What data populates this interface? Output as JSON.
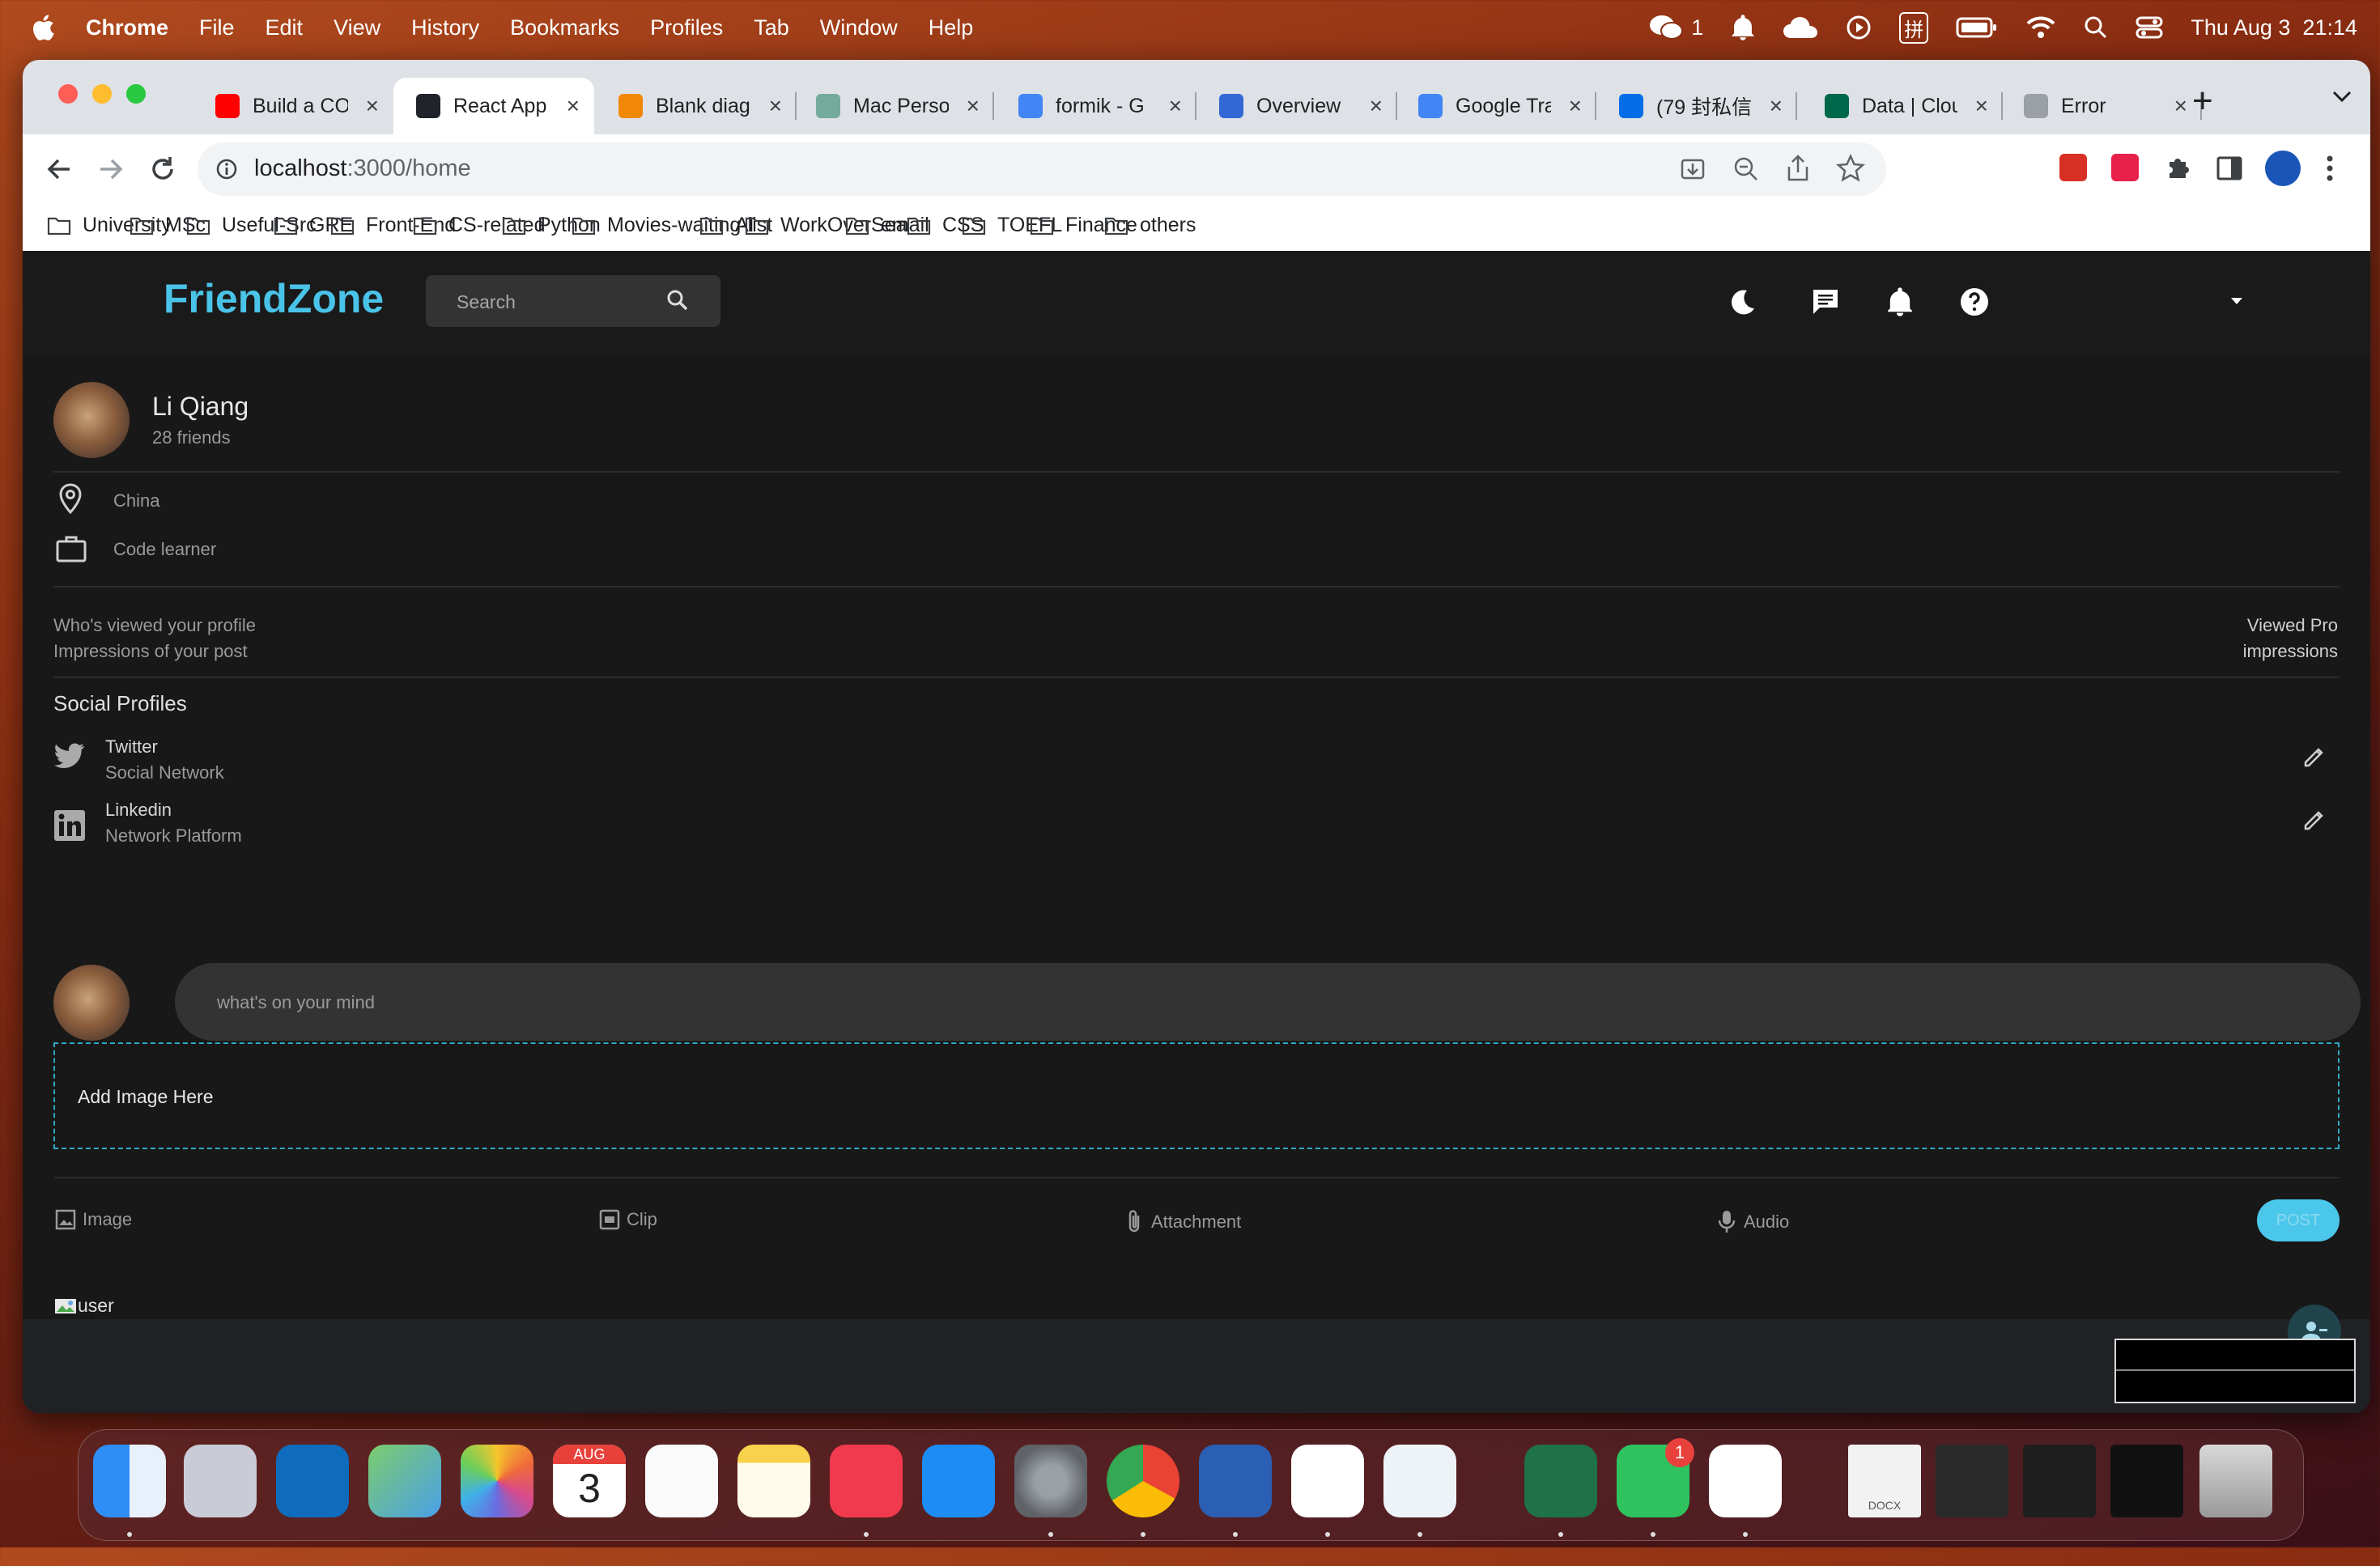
{
  "menubar": {
    "app": "Chrome",
    "items": [
      "File",
      "Edit",
      "View",
      "History",
      "Bookmarks",
      "Profiles",
      "Tab",
      "Window",
      "Help"
    ],
    "wechat_count": "1",
    "input_method": "拼",
    "datetime": "Thu Aug 3  21:14"
  },
  "tabs": [
    {
      "title": "Build a CO",
      "fav_color": "#ff0000"
    },
    {
      "title": "React App",
      "fav_color": "#20232a"
    },
    {
      "title": "Blank diag",
      "fav_color": "#f08705"
    },
    {
      "title": "Mac Perso",
      "fav_color": "#74aa9c"
    },
    {
      "title": "formik - G",
      "fav_color": "#4285f4"
    },
    {
      "title": "Overview",
      "fav_color": "#3367d6"
    },
    {
      "title": "Google Tra",
      "fav_color": "#4285f4"
    },
    {
      "title": "(79 封私信",
      "fav_color": "#056de8"
    },
    {
      "title": "Data | Clou",
      "fav_color": "#00684a"
    },
    {
      "title": "Error",
      "fav_color": "#9aa0a6"
    }
  ],
  "omnibox": {
    "host": "localhost",
    "path": ":3000/home"
  },
  "bookmarks": [
    "University",
    "MSc",
    "Useful-Src",
    "GRE",
    "Front-End",
    "CS-related",
    "Python",
    "Movies-waiting-list",
    "AI",
    "WorkOverSea",
    "email",
    "CSS",
    "TOEFL",
    "Finance",
    "others"
  ],
  "app": {
    "logo": "FriendZone",
    "search_placeholder": "Search",
    "user": {
      "name": "Li Qiang",
      "friends": "28 friends",
      "location": "China",
      "occupation": "Code learner"
    },
    "stats": {
      "viewed_label": "Who's viewed your profile",
      "impressions_label": "Impressions of your post",
      "viewed_value": "Viewed Pro",
      "impressions_value": "impressions"
    },
    "social_title": "Social Profiles",
    "socials": [
      {
        "name": "Twitter",
        "type": "Social Network"
      },
      {
        "name": "Linkedin",
        "type": "Network Platform"
      }
    ],
    "post_placeholder": "what's on your mind",
    "dropzone_text": "Add Image Here",
    "actions": {
      "image": "Image",
      "clip": "Clip",
      "attachment": "Attachment",
      "audio": "Audio",
      "post": "POST"
    },
    "broken_image_alt": "user"
  },
  "dock": {
    "calendar_month": "AUG",
    "calendar_day": "3",
    "wechat_badge": "1",
    "doc_label": "DOCX"
  },
  "colors": {
    "accent": "#4ac3e8",
    "background": "#181818",
    "dashed_border": "#2fa8c9"
  }
}
